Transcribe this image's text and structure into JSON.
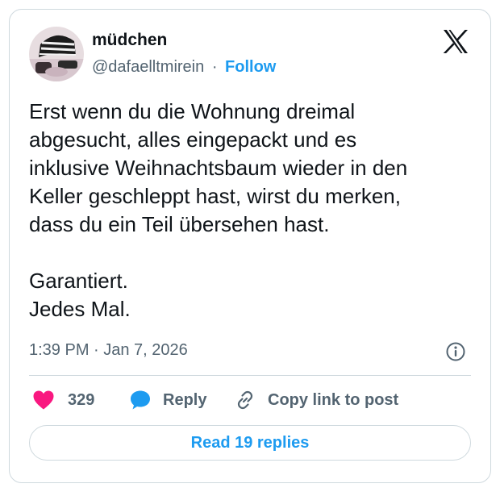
{
  "author": {
    "display_name": "müdchen",
    "handle": "@dafaelltmirein",
    "separator": "·",
    "follow_label": "Follow"
  },
  "tweet": {
    "text": "Erst wenn du die Wohnung dreimal\nabgesucht, alles eingepackt und es\ninklusive Weihnachtsbaum wieder in den\nKeller geschleppt hast, wirst du merken,\ndass du ein Teil übersehen hast.\n\nGarantiert.\nJedes Mal.",
    "timestamp": "1:39 PM · Jan 7, 2026"
  },
  "actions": {
    "like_count": "329",
    "reply_label": "Reply",
    "copy_link_label": "Copy link to post"
  },
  "footer": {
    "read_replies_label": "Read 19 replies"
  },
  "icons": {
    "logo": "x-logo-icon",
    "info": "info-icon",
    "like": "heart-icon",
    "reply": "speech-bubble-icon",
    "copy": "link-icon"
  },
  "colors": {
    "accent": "#1d9bf0",
    "like": "#f91880",
    "text_primary": "#0f1419",
    "text_secondary": "#536471",
    "border": "#cfd9de"
  }
}
